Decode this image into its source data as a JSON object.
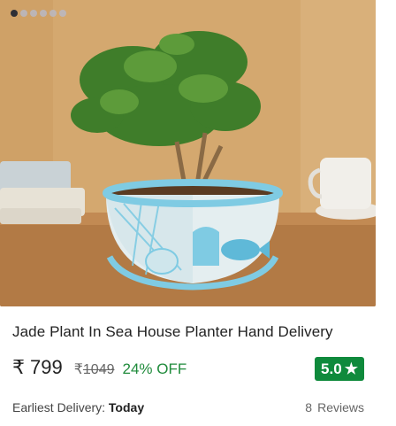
{
  "carousel": {
    "dot_count": 6,
    "active_index": 0
  },
  "product": {
    "title": "Jade Plant In Sea House Planter Hand Delivery",
    "currency": "₹",
    "price": "799",
    "mrp": "1049",
    "discount": "24% OFF",
    "rating": "5.0",
    "rating_icon": "star-icon",
    "delivery_label": "Earliest Delivery:",
    "delivery_value": "Today",
    "review_count": "8",
    "reviews_label": "Reviews"
  },
  "colors": {
    "discount_green": "#1f8b3b",
    "rating_badge": "#0f8a3c",
    "planter_blue": "#7fcbe3"
  }
}
